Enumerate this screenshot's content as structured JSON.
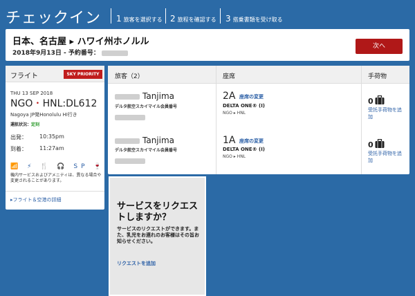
{
  "header": {
    "title": "チェックイン",
    "steps": [
      {
        "num": "1",
        "label": "旅客を選択する"
      },
      {
        "num": "2",
        "label": "旅程を確認する"
      },
      {
        "num": "3",
        "label": "搭乗書類を受け取る"
      }
    ]
  },
  "trip": {
    "route": "日本、名古屋 ▸ ハワイ州ホノルル",
    "date_conf": "2018年9月13日 - 予約番号：",
    "next_label": "次へ"
  },
  "flight": {
    "title": "フライト",
    "badge": "SKY PRIORITY",
    "date": "THU 13 SEP 2018",
    "origin": "NGO",
    "dot": "•",
    "dest_flight": "HNL:DL612",
    "route_text": "Nagoya JP発Honolulu HI行き",
    "status_label": "運航状況：",
    "status_value": "定刻",
    "depart_label": "出発：",
    "depart_time": "10:35pm",
    "arrive_label": "到着：",
    "arrive_time": "11:27am",
    "amenities": "📶 ⚡ 🍴 🎧 SP 🍷",
    "amenity_note": "機内サービスおよびアメニティは、異なる場合や変更されることがあります。",
    "details_link": "▸フライト＆空港の詳細"
  },
  "pax_table": {
    "headers": {
      "passengers": "旅客（2）",
      "seat": "座席",
      "baggage": "手荷物"
    },
    "rows": [
      {
        "surname": "Tanjima",
        "mileage_label": "デルタ航空スカイマイル会員番号",
        "seat": "2A",
        "seat_change": "座席の変更",
        "cabin": "DELTA ONE® (I)",
        "segment": "NGO ▸ HNL",
        "bags": "0",
        "bag_link": "受託手荷物を追加"
      },
      {
        "surname": "Tanjima",
        "mileage_label": "デルタ航空スカイマイル会員番号",
        "seat": "1A",
        "seat_change": "座席の変更",
        "cabin": "DELTA ONE® (I)",
        "segment": "NGO ▸ HNL",
        "bags": "0",
        "bag_link": "受託手荷物を追加"
      }
    ]
  },
  "service": {
    "title": "サービスをリクエストしますか？",
    "body": "サービスのリクエストができます。また、乳児をお連れのお客様はその旨お知らせください。",
    "link": "リクエストを追加"
  },
  "colors": {
    "background": "#2b6aa6",
    "brand_red": "#b01818",
    "link": "#2b5fa6"
  }
}
